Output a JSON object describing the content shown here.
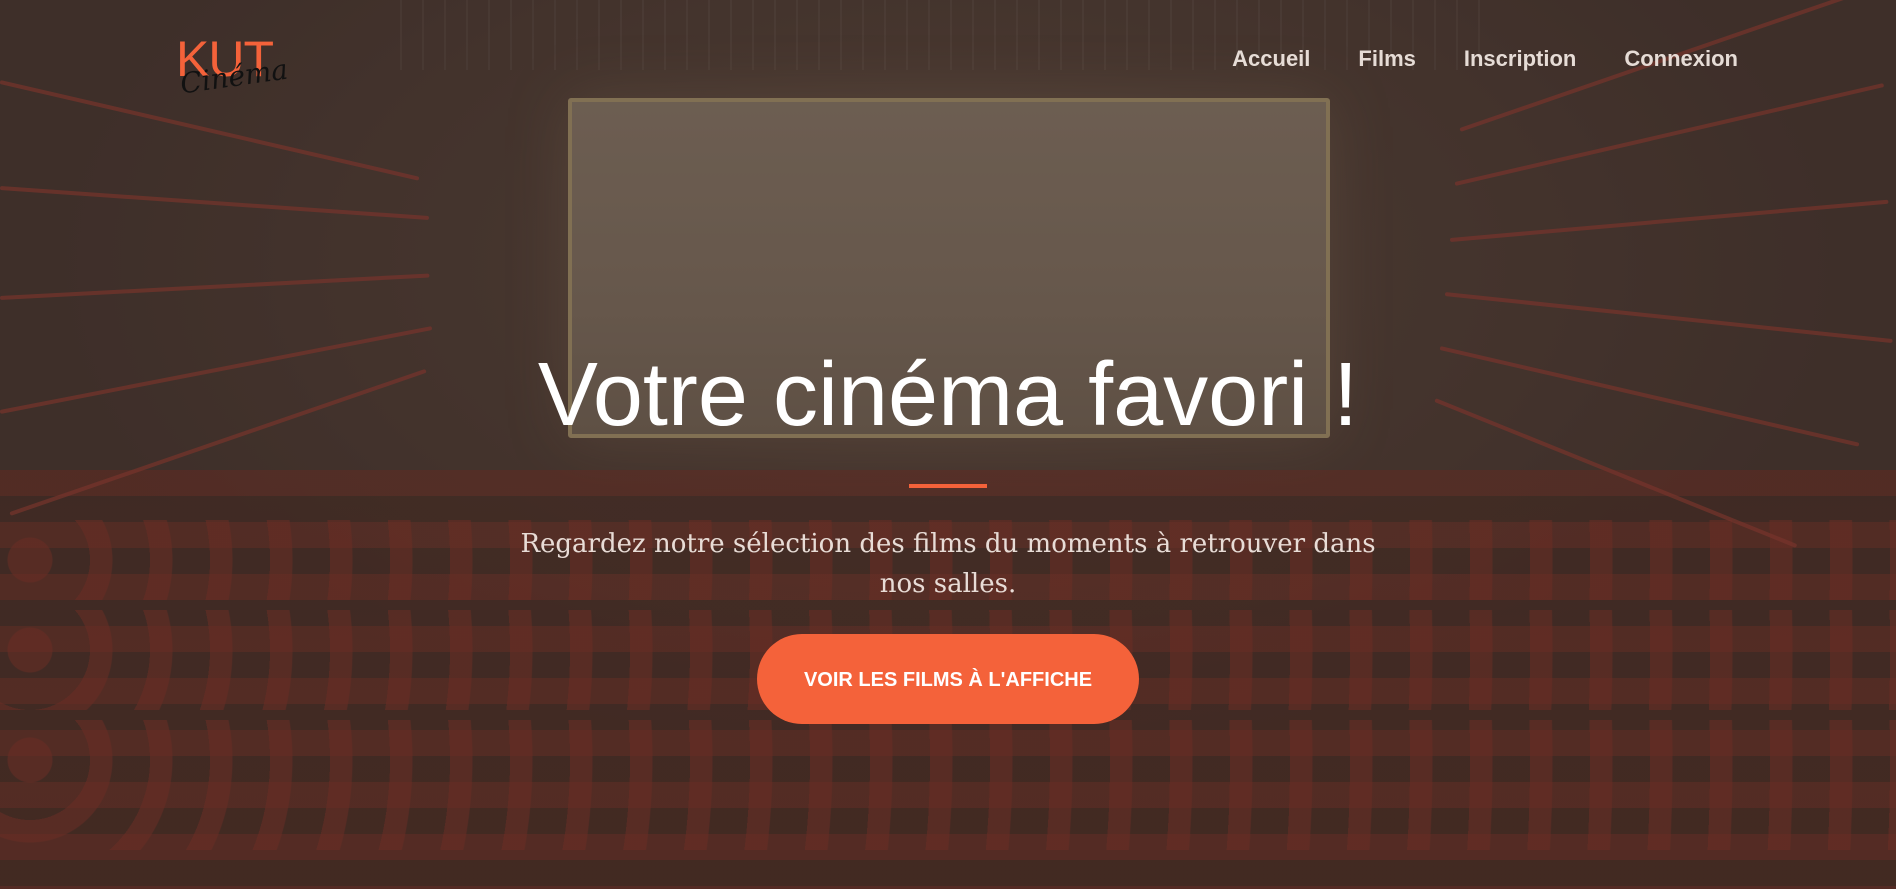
{
  "brand": {
    "logo_main": "KUT",
    "logo_script": "Cinéma",
    "accent_color": "#f4623a"
  },
  "nav": {
    "items": [
      {
        "label": "Accueil"
      },
      {
        "label": "Films"
      },
      {
        "label": "Inscription"
      },
      {
        "label": "Connexion"
      }
    ]
  },
  "hero": {
    "title": "Votre cinéma favori !",
    "subtitle": "Regardez notre sélection des films du moments à retrouver dans nos salles.",
    "cta_label": "VOIR LES FILMS À L'AFFICHE"
  }
}
